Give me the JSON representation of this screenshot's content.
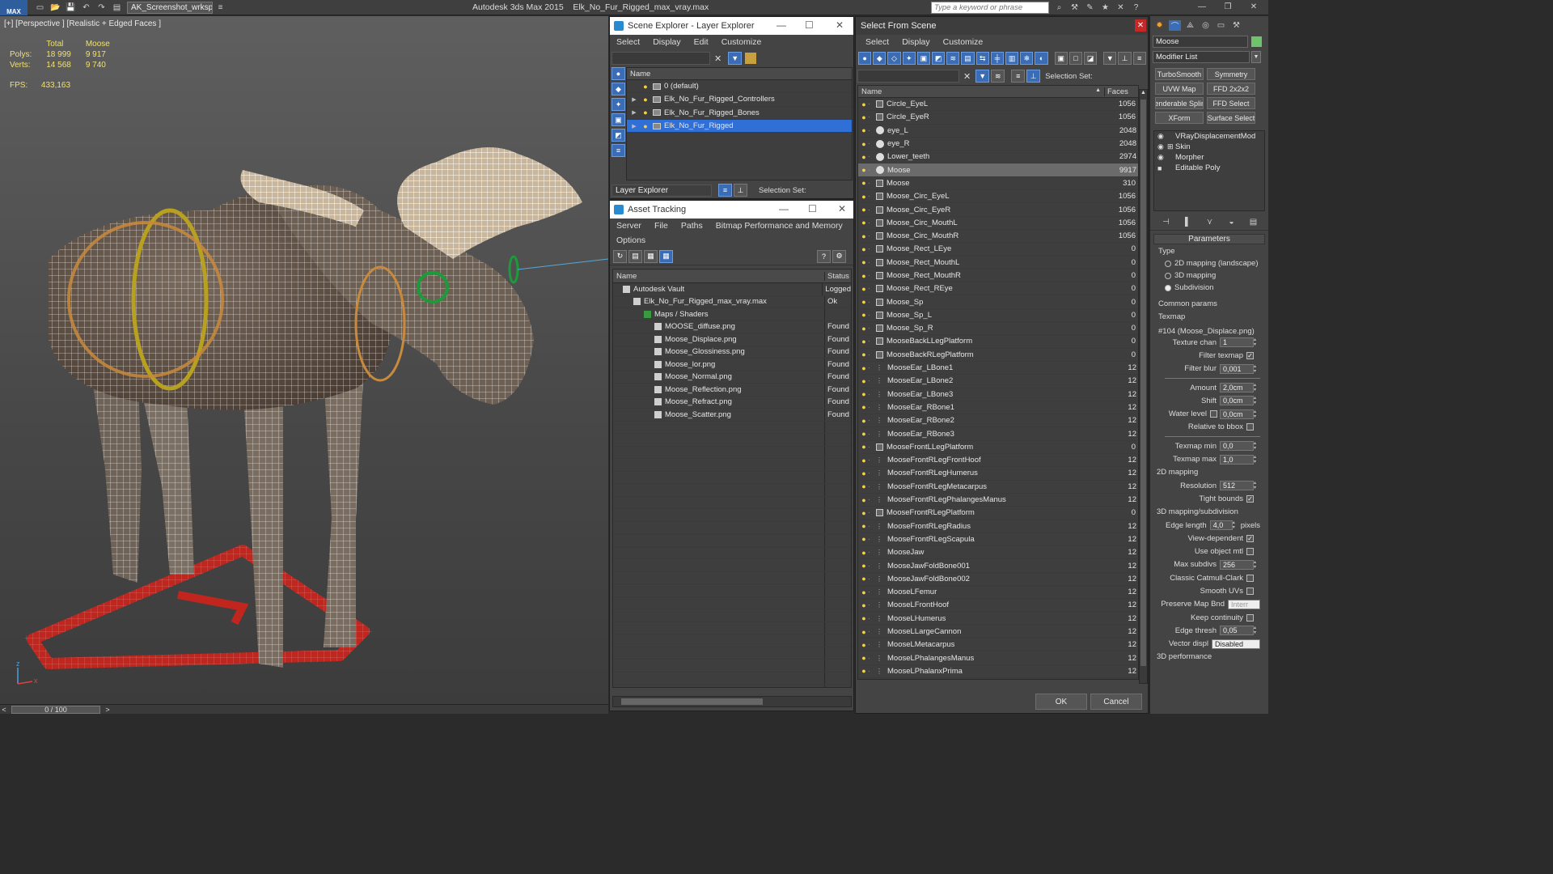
{
  "titlebar": {
    "app_logo": "MAX",
    "workspace": "AK_Screenshot_wrksp",
    "app_name": "Autodesk 3ds Max  2015",
    "file_name": "Elk_No_Fur_Rigged_max_vray.max",
    "search_placeholder": "Type a keyword or phrase"
  },
  "viewport": {
    "label": "[+] [Perspective ] [Realistic + Edged Faces ]",
    "stats_head": [
      "Total",
      "Moose"
    ],
    "polys_label": "Polys:",
    "polys": [
      "18 999",
      "9 917"
    ],
    "verts_label": "Verts:",
    "verts": [
      "14 568",
      "9 740"
    ],
    "fps_label": "FPS:",
    "fps": "433,163",
    "timeline": "0 / 100",
    "axis_x": "x",
    "axis_z": "z"
  },
  "scene_explorer": {
    "title": "Scene Explorer - Layer Explorer",
    "menu": [
      "Select",
      "Display",
      "Edit",
      "Customize"
    ],
    "col_name": "Name",
    "layers": [
      "0 (default)",
      "Elk_No_Fur_Rigged_Controllers",
      "Elk_No_Fur_Rigged_Bones",
      "Elk_No_Fur_Rigged"
    ],
    "footer_combo": "Layer Explorer",
    "selection_set": "Selection Set:"
  },
  "asset_tracking": {
    "title": "Asset Tracking",
    "menu": [
      "Server",
      "File",
      "Paths",
      "Bitmap Performance and Memory"
    ],
    "menu2": "Options",
    "col_name": "Name",
    "col_status": "Status",
    "rows": [
      {
        "name": "Autodesk Vault",
        "status": "Logged",
        "indent": 0
      },
      {
        "name": "Elk_No_Fur_Rigged_max_vray.max",
        "status": "Ok",
        "indent": 1
      },
      {
        "name": "Maps / Shaders",
        "status": "",
        "indent": 2
      },
      {
        "name": "MOOSE_diffuse.png",
        "status": "Found",
        "indent": 3
      },
      {
        "name": "Moose_Displace.png",
        "status": "Found",
        "indent": 3
      },
      {
        "name": "Moose_Glossiness.png",
        "status": "Found",
        "indent": 3
      },
      {
        "name": "Moose_lor.png",
        "status": "Found",
        "indent": 3
      },
      {
        "name": "Moose_Normal.png",
        "status": "Found",
        "indent": 3
      },
      {
        "name": "Moose_Reflection.png",
        "status": "Found",
        "indent": 3
      },
      {
        "name": "Moose_Refract.png",
        "status": "Found",
        "indent": 3
      },
      {
        "name": "Moose_Scatter.png",
        "status": "Found",
        "indent": 3
      }
    ]
  },
  "select_scene": {
    "title": "Select From Scene",
    "menu": [
      "Select",
      "Display",
      "Customize"
    ],
    "selection_set": "Selection Set:",
    "col_name": "Name",
    "col_faces": "Faces",
    "ok": "OK",
    "cancel": "Cancel",
    "rows": [
      {
        "name": "Circle_EyeL",
        "faces": "1056",
        "icon": "w"
      },
      {
        "name": "Circle_EyeR",
        "faces": "1056",
        "icon": "w"
      },
      {
        "name": "eye_L",
        "faces": "2048",
        "icon": "o"
      },
      {
        "name": "eye_R",
        "faces": "2048",
        "icon": "o"
      },
      {
        "name": "Lower_teeth",
        "faces": "2974",
        "icon": "o"
      },
      {
        "name": "Moose",
        "faces": "9917",
        "icon": "o"
      },
      {
        "name": "Moose",
        "faces": "310",
        "icon": "w"
      },
      {
        "name": "Moose_Circ_EyeL",
        "faces": "1056",
        "icon": "w"
      },
      {
        "name": "Moose_Circ_EyeR",
        "faces": "1056",
        "icon": "w"
      },
      {
        "name": "Moose_Circ_MouthL",
        "faces": "1056",
        "icon": "w"
      },
      {
        "name": "Moose_Circ_MouthR",
        "faces": "1056",
        "icon": "w"
      },
      {
        "name": "Moose_Rect_LEye",
        "faces": "0",
        "icon": "w"
      },
      {
        "name": "Moose_Rect_MouthL",
        "faces": "0",
        "icon": "w"
      },
      {
        "name": "Moose_Rect_MouthR",
        "faces": "0",
        "icon": "w"
      },
      {
        "name": "Moose_Rect_REye",
        "faces": "0",
        "icon": "w"
      },
      {
        "name": "Moose_Sp",
        "faces": "0",
        "icon": "w"
      },
      {
        "name": "Moose_Sp_L",
        "faces": "0",
        "icon": "w"
      },
      {
        "name": "Moose_Sp_R",
        "faces": "0",
        "icon": "w"
      },
      {
        "name": "MooseBackLLegPlatform",
        "faces": "0",
        "icon": "w"
      },
      {
        "name": "MooseBackRLegPlatform",
        "faces": "0",
        "icon": "w"
      },
      {
        "name": "MooseEar_LBone1",
        "faces": "12",
        "icon": "b"
      },
      {
        "name": "MooseEar_LBone2",
        "faces": "12",
        "icon": "b"
      },
      {
        "name": "MooseEar_LBone3",
        "faces": "12",
        "icon": "b"
      },
      {
        "name": "MooseEar_RBone1",
        "faces": "12",
        "icon": "b"
      },
      {
        "name": "MooseEar_RBone2",
        "faces": "12",
        "icon": "b"
      },
      {
        "name": "MooseEar_RBone3",
        "faces": "12",
        "icon": "b"
      },
      {
        "name": "MooseFrontLLegPlatform",
        "faces": "0",
        "icon": "w"
      },
      {
        "name": "MooseFrontRLegFrontHoof",
        "faces": "12",
        "icon": "b"
      },
      {
        "name": "MooseFrontRLegHumerus",
        "faces": "12",
        "icon": "b"
      },
      {
        "name": "MooseFrontRLegMetacarpus",
        "faces": "12",
        "icon": "b"
      },
      {
        "name": "MooseFrontRLegPhalangesManus",
        "faces": "12",
        "icon": "b"
      },
      {
        "name": "MooseFrontRLegPlatform",
        "faces": "0",
        "icon": "w"
      },
      {
        "name": "MooseFrontRLegRadius",
        "faces": "12",
        "icon": "b"
      },
      {
        "name": "MooseFrontRLegScapula",
        "faces": "12",
        "icon": "b"
      },
      {
        "name": "MooseJaw",
        "faces": "12",
        "icon": "b"
      },
      {
        "name": "MooseJawFoldBone001",
        "faces": "12",
        "icon": "b"
      },
      {
        "name": "MooseJawFoldBone002",
        "faces": "12",
        "icon": "b"
      },
      {
        "name": "MooseLFemur",
        "faces": "12",
        "icon": "b"
      },
      {
        "name": "MooseLFrontHoof",
        "faces": "12",
        "icon": "b"
      },
      {
        "name": "MooseLHumerus",
        "faces": "12",
        "icon": "b"
      },
      {
        "name": "MooseLLargeCannon",
        "faces": "12",
        "icon": "b"
      },
      {
        "name": "MooseLMetacarpus",
        "faces": "12",
        "icon": "b"
      },
      {
        "name": "MooseLPhalangesManus",
        "faces": "12",
        "icon": "b"
      },
      {
        "name": "MooseLPhalanxPrima",
        "faces": "12",
        "icon": "b"
      }
    ]
  },
  "command_panel": {
    "object_name": "Moose",
    "modifier_list": "Modifier List",
    "mod_buttons": [
      "TurboSmooth",
      "Symmetry",
      "UVW Map",
      "FFD 2x2x2",
      "Renderable Spline",
      "FFD Select",
      "XForm",
      "Surface Select"
    ],
    "stack": [
      "VRayDisplacementMod",
      "Skin",
      "Morpher",
      "Editable Poly"
    ],
    "parameters": "Parameters",
    "type_label": "Type",
    "type_options": [
      "2D mapping (landscape)",
      "3D mapping",
      "Subdivision"
    ],
    "common_params": "Common params",
    "texmap_label": "Texmap",
    "texmap_value": "#104 (Moose_Displace.png)",
    "texture_chan": "Texture chan",
    "texture_chan_val": "1",
    "filter_texmap": "Filter texmap",
    "filter_blur": "Filter blur",
    "filter_blur_val": "0,001",
    "amount": "Amount",
    "amount_val": "2,0cm",
    "shift": "Shift",
    "shift_val": "0,0cm",
    "water_level": "Water level",
    "water_level_val": "0,0cm",
    "relative_bbox": "Relative to bbox",
    "texmap_min": "Texmap min",
    "texmap_min_val": "0,0",
    "texmap_max": "Texmap max",
    "texmap_max_val": "1,0",
    "mapping_2d": "2D mapping",
    "resolution": "Resolution",
    "resolution_val": "512",
    "tight_bounds": "Tight bounds",
    "mapping_3d": "3D mapping/subdivision",
    "edge_length": "Edge length",
    "edge_length_val": "4,0",
    "pixels": "pixels",
    "view_dependent": "View-dependent",
    "use_object_mtl": "Use object mtl",
    "max_subdivs": "Max subdivs",
    "max_subdivs_val": "256",
    "classic_cc": "Classic Catmull-Clark",
    "smooth_uvs": "Smooth UVs",
    "preserve_map": "Preserve Map Bnd",
    "preserve_map_val": "Interr",
    "keep_continuity": "Keep continuity",
    "edge_thresh": "Edge thresh",
    "edge_thresh_val": "0,05",
    "vector_displ": "Vector displ",
    "vector_displ_val": "Disabled",
    "perf_3d": "3D performance"
  },
  "colors": {
    "accent": "#2f6fd6",
    "bulb": "#f2d24a",
    "stats": "#f0e070"
  }
}
